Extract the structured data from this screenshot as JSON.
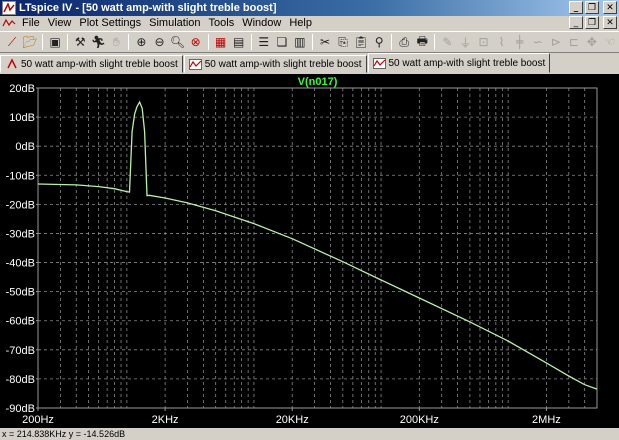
{
  "window": {
    "title": "LTspice IV - [50 watt amp-with slight treble boost]"
  },
  "menu": {
    "items": [
      "File",
      "View",
      "Plot Settings",
      "Simulation",
      "Tools",
      "Window",
      "Help"
    ]
  },
  "toolbar": {
    "icons": [
      "new-schematic-icon",
      "open-icon",
      "save-icon",
      "control-panel-icon",
      "run-icon",
      "halt-icon",
      "zoom-in-icon",
      "zoom-out-icon",
      "zoom-box-icon",
      "zoom-fit-icon",
      "autorange-icon",
      "tile-horizontal-icon",
      "cascade-icon",
      "tile-vertical-icon",
      "cut-icon",
      "copy-icon",
      "paste-icon",
      "find-icon",
      "print-setup-icon",
      "print-icon",
      "wire-icon",
      "ground-icon",
      "label-icon",
      "resistor-icon",
      "capacitor-icon",
      "inductor-icon",
      "diode-icon",
      "component-icon",
      "move-icon",
      "drag-icon"
    ]
  },
  "tabs": [
    {
      "label": "50 watt amp-with slight treble boost",
      "icon": "schematic-icon",
      "active": false
    },
    {
      "label": "50 watt amp-with slight treble boost",
      "icon": "waveform-icon",
      "active": false
    },
    {
      "label": "50 watt amp-with slight treble boost",
      "icon": "waveform-icon",
      "active": true
    }
  ],
  "colors": {
    "trace": "#b8f0a8",
    "grid": "#8a8a8a",
    "axis_text": "#ffffff",
    "trace_label": "#33ff33",
    "plot_bg": "#000000"
  },
  "chart_data": {
    "type": "line",
    "title": "V(n017)",
    "xlabel": "",
    "ylabel": "",
    "x_scale": "log",
    "xlim": [
      200,
      5000000
    ],
    "ylim": [
      -90,
      20
    ],
    "x_ticks": [
      {
        "value": 200,
        "label": "200Hz"
      },
      {
        "value": 2000,
        "label": "2KHz"
      },
      {
        "value": 20000,
        "label": "20KHz"
      },
      {
        "value": 200000,
        "label": "200KHz"
      },
      {
        "value": 2000000,
        "label": "2MHz"
      }
    ],
    "y_ticks": [
      {
        "value": 20,
        "label": "20dB"
      },
      {
        "value": 10,
        "label": "10dB"
      },
      {
        "value": 0,
        "label": "0dB"
      },
      {
        "value": -10,
        "label": "-10dB"
      },
      {
        "value": -20,
        "label": "-20dB"
      },
      {
        "value": -30,
        "label": "-30dB"
      },
      {
        "value": -40,
        "label": "-40dB"
      },
      {
        "value": -50,
        "label": "-50dB"
      },
      {
        "value": -60,
        "label": "-60dB"
      },
      {
        "value": -70,
        "label": "-70dB"
      },
      {
        "value": -80,
        "label": "-80dB"
      },
      {
        "value": -90,
        "label": "-90dB"
      }
    ],
    "grid": true,
    "series": [
      {
        "name": "V(n017)",
        "points": [
          [
            200,
            -13
          ],
          [
            400,
            -13.3
          ],
          [
            600,
            -13.9
          ],
          [
            800,
            -14.6
          ],
          [
            1000,
            -15.6
          ],
          [
            1050,
            -15.8
          ],
          [
            1100,
            5
          ],
          [
            1150,
            11
          ],
          [
            1200,
            13.5
          ],
          [
            1260,
            15.2
          ],
          [
            1320,
            13
          ],
          [
            1380,
            5
          ],
          [
            1440,
            -17
          ],
          [
            1500,
            -16.9
          ],
          [
            2000,
            -17.8
          ],
          [
            3000,
            -19.5
          ],
          [
            5000,
            -22.2
          ],
          [
            10000,
            -26.6
          ],
          [
            20000,
            -31.8
          ],
          [
            50000,
            -39.7
          ],
          [
            100000,
            -46
          ],
          [
            200000,
            -52.2
          ],
          [
            500000,
            -60.4
          ],
          [
            1000000,
            -67
          ],
          [
            2000000,
            -74.5
          ],
          [
            3000000,
            -79
          ],
          [
            4000000,
            -82
          ],
          [
            5000000,
            -83.5
          ]
        ]
      }
    ]
  },
  "status": {
    "readout": "x = 214.838KHz   y = -14.526dB"
  }
}
